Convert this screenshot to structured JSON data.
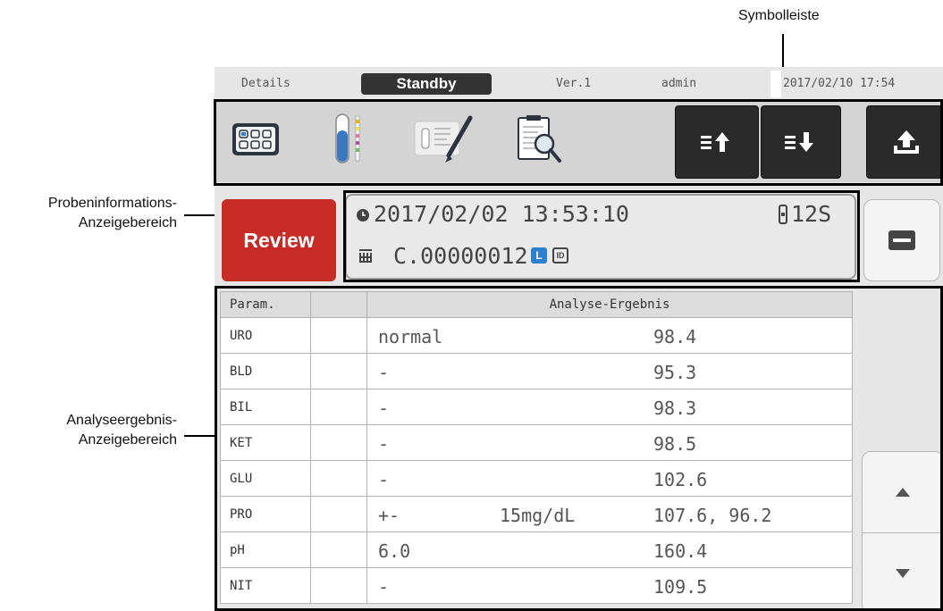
{
  "annotations": {
    "toolbar": "Symbolleiste",
    "sample_info_line1": "Probeninformations-",
    "sample_info_line2": "Anzeigebereich",
    "results_line1": "Analyseergebnis-",
    "results_line2": "Anzeigebereich"
  },
  "status_bar": {
    "section": "Details",
    "state": "Standby",
    "version": "Ver.1",
    "user": "admin",
    "datetime": "2017/02/10 17:54"
  },
  "toolbar": {
    "icons": [
      "measurement-grid-icon",
      "test-tube-icon",
      "strip-edit-icon",
      "report-search-icon"
    ],
    "buttons": [
      "sort-ascending-icon",
      "sort-descending-icon",
      "upload-icon"
    ]
  },
  "sample": {
    "review_label": "Review",
    "datetime": "2017/02/02 13:53:10",
    "rack_position": "12S",
    "sample_id": "C.00000012",
    "badge_l": "L",
    "badge_id": "ID"
  },
  "results": {
    "header_param": "Param.",
    "header_result": "Analyse-Ergebnis",
    "rows": [
      {
        "param": "URO",
        "qual": "normal",
        "conc": "",
        "raw": "98.4"
      },
      {
        "param": "BLD",
        "qual": " -",
        "conc": "",
        "raw": "95.3"
      },
      {
        "param": "BIL",
        "qual": " -",
        "conc": "",
        "raw": "98.3"
      },
      {
        "param": "KET",
        "qual": " -",
        "conc": "",
        "raw": "98.5"
      },
      {
        "param": "GLU",
        "qual": " -",
        "conc": "",
        "raw": "102.6"
      },
      {
        "param": "PRO",
        "qual": "+-",
        "conc": "15mg/dL",
        "raw": "107.6, 96.2"
      },
      {
        "param": "pH",
        "qual": "6.0",
        "conc": "",
        "raw": "160.4"
      },
      {
        "param": "NIT",
        "qual": " -",
        "conc": "",
        "raw": "109.5"
      }
    ]
  },
  "colors": {
    "review": "#c62b25",
    "status_state_bg": "#333333",
    "toolbar_button_bg": "#2a2a2a",
    "badge_blue": "#2d7fd0"
  }
}
